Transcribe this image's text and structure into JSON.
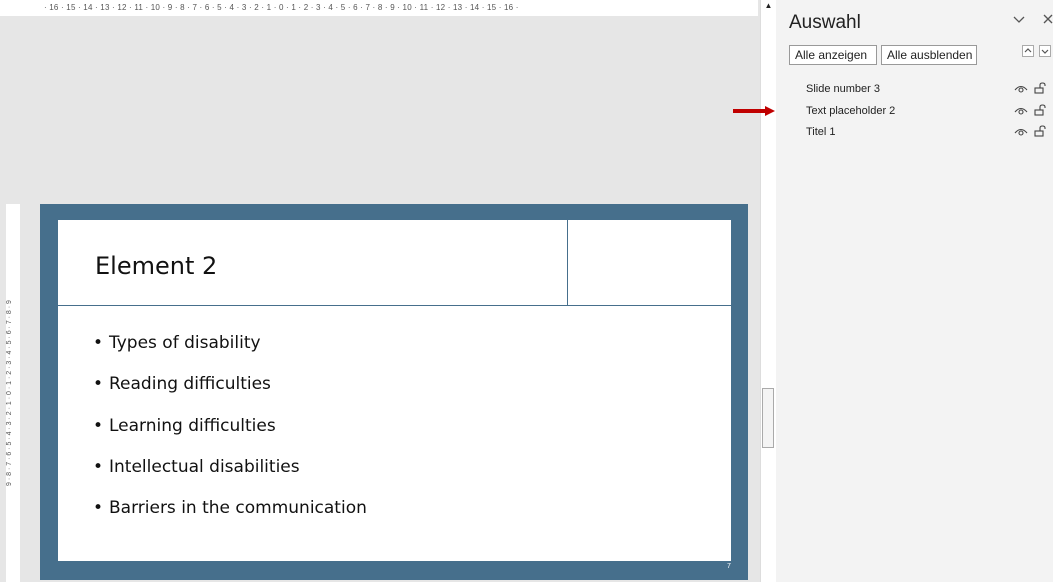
{
  "ruler": {
    "horizontal": "· 16 · 15 · 14 · 13 · 12 · 11 · 10 · 9 · 8 · 7 · 6 · 5 · 4 · 3 · 2 · 1 · 0 · 1 · 2 · 3 · 4 · 5 · 6 · 7 · 8 · 9 · 10 · 11 · 12 · 13 · 14 · 15 · 16 ·",
    "vertical": "9 · 8 · 7 · 6 · 5 · 4 · 3 · 2 · 1 · 0 · 1 · 2 · 3 · 4 · 5 · 6 · 7 · 8 · 9"
  },
  "slide": {
    "title": "Element 2",
    "bullets": [
      "Types of disability",
      "Reading difficulties",
      "Learning difficulties",
      "Intellectual disabilities",
      "Barriers in the communication"
    ],
    "bullet_char": "•",
    "slide_number": "7"
  },
  "selection_pane": {
    "title": "Auswahl",
    "collapse_icon": "chevron-down-icon",
    "close_icon": "close-icon",
    "show_all_label": "Alle anzeigen",
    "hide_all_label": "Alle ausblenden",
    "items": [
      {
        "label": "Slide number 3"
      },
      {
        "label": "Text placeholder  2"
      },
      {
        "label": "Titel 1"
      }
    ]
  },
  "colors": {
    "slide_frame": "#466f8c",
    "arrow": "#c00000"
  }
}
